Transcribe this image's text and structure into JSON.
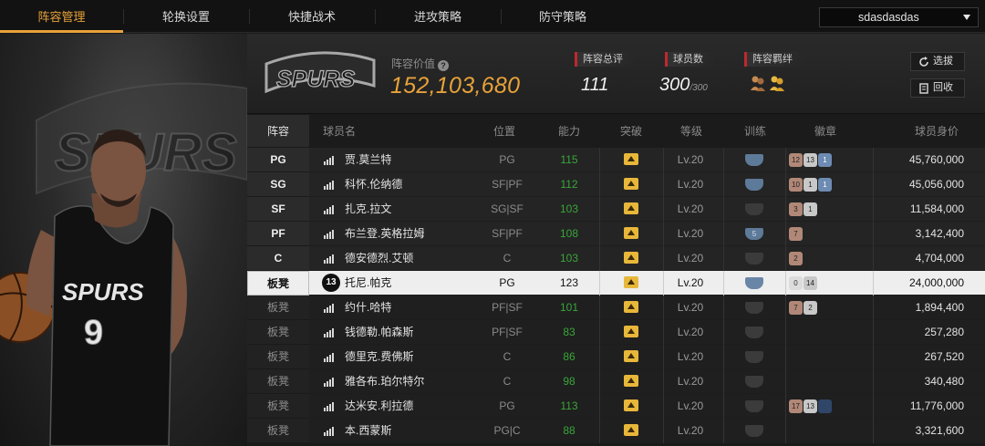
{
  "nav": {
    "tabs": [
      "阵容管理",
      "轮换设置",
      "快捷战术",
      "进攻策略",
      "防守策略"
    ],
    "team_select": "sdasdasdas"
  },
  "header": {
    "value_label": "阵容价值",
    "value": "152,103,680",
    "team_logo_text": "SPURS",
    "stats": [
      {
        "label": "阵容总评",
        "value": "111",
        "suffix": ""
      },
      {
        "label": "球员数",
        "value": "300",
        "suffix": "/300"
      },
      {
        "label": "阵容羁绊",
        "value": "",
        "suffix": ""
      }
    ],
    "btn_pick": "选拔",
    "btn_recycle": "回收"
  },
  "table": {
    "headers": [
      "阵容",
      "球员名",
      "位置",
      "能力",
      "突破",
      "等级",
      "训练",
      "徽章",
      "球员身价"
    ],
    "rows": [
      {
        "slot": "PG",
        "name": "贾.莫兰特",
        "pos": "PG",
        "ovr": "115",
        "lv": "Lv.20",
        "train": "blue",
        "train_num": "",
        "badges": [
          [
            "12",
            "bronze"
          ],
          [
            "13",
            "silver"
          ],
          [
            "1",
            "blue"
          ]
        ],
        "price": "45,760,000",
        "type": "starter"
      },
      {
        "slot": "SG",
        "name": "科怀.伦纳德",
        "pos": "SF|PF",
        "ovr": "112",
        "lv": "Lv.20",
        "train": "blue",
        "train_num": "",
        "badges": [
          [
            "10",
            "bronze"
          ],
          [
            "1",
            "silver"
          ],
          [
            "1",
            "blue"
          ]
        ],
        "price": "45,056,000",
        "type": "starter"
      },
      {
        "slot": "SF",
        "name": "扎克.拉文",
        "pos": "SG|SF",
        "ovr": "103",
        "lv": "Lv.20",
        "train": "grey",
        "train_num": "",
        "badges": [
          [
            "3",
            "bronze"
          ],
          [
            "1",
            "silver"
          ]
        ],
        "price": "11,584,000",
        "type": "starter"
      },
      {
        "slot": "PF",
        "name": "布兰登.英格拉姆",
        "pos": "SF|PF",
        "ovr": "108",
        "lv": "Lv.20",
        "train": "blue",
        "train_num": "5",
        "badges": [
          [
            "7",
            "bronze"
          ]
        ],
        "price": "3,142,400",
        "type": "starter"
      },
      {
        "slot": "C",
        "name": "德安德烈.艾顿",
        "pos": "C",
        "ovr": "103",
        "lv": "Lv.20",
        "train": "grey",
        "train_num": "",
        "badges": [
          [
            "2",
            "bronze"
          ]
        ],
        "price": "4,704,000",
        "type": "starter"
      },
      {
        "slot": "板凳",
        "name": "托尼.帕克",
        "jersey": "13",
        "pos": "PG",
        "ovr": "123",
        "lv": "Lv.20",
        "train": "hl",
        "train_num": "",
        "badges": [
          [
            "0",
            "dim"
          ],
          [
            "14",
            "silver"
          ]
        ],
        "price": "24,000,000",
        "type": "hl"
      },
      {
        "slot": "板凳",
        "name": "约什.哈特",
        "pos": "PF|SF",
        "ovr": "101",
        "lv": "Lv.20",
        "train": "grey",
        "train_num": "",
        "badges": [
          [
            "7",
            "bronze"
          ],
          [
            "2",
            "silver"
          ]
        ],
        "price": "1,894,400",
        "type": "bench"
      },
      {
        "slot": "板凳",
        "name": "钱德勒.帕森斯",
        "pos": "PF|SF",
        "ovr": "83",
        "lv": "Lv.20",
        "train": "grey",
        "train_num": "",
        "badges": [],
        "price": "257,280",
        "type": "bench"
      },
      {
        "slot": "板凳",
        "name": "德里克.费佛斯",
        "pos": "C",
        "ovr": "86",
        "lv": "Lv.20",
        "train": "grey",
        "train_num": "",
        "badges": [],
        "price": "267,520",
        "type": "bench"
      },
      {
        "slot": "板凳",
        "name": "雅各布.珀尔特尔",
        "pos": "C",
        "ovr": "98",
        "lv": "Lv.20",
        "train": "grey",
        "train_num": "",
        "badges": [],
        "price": "340,480",
        "type": "bench"
      },
      {
        "slot": "板凳",
        "name": "达米安.利拉德",
        "pos": "PG",
        "ovr": "113",
        "lv": "Lv.20",
        "train": "grey",
        "train_num": "",
        "badges": [
          [
            "17",
            "bronze"
          ],
          [
            "13",
            "silver"
          ],
          [
            "",
            "navy"
          ]
        ],
        "price": "11,776,000",
        "type": "bench"
      },
      {
        "slot": "板凳",
        "name": "本.西蒙斯",
        "pos": "PG|C",
        "ovr": "88",
        "lv": "Lv.20",
        "train": "grey",
        "train_num": "",
        "badges": [],
        "price": "3,321,600",
        "type": "bench"
      }
    ]
  },
  "colors": {
    "accent": "#e8a23a",
    "green": "#3aa53a",
    "red_marker": "#c0282d"
  }
}
